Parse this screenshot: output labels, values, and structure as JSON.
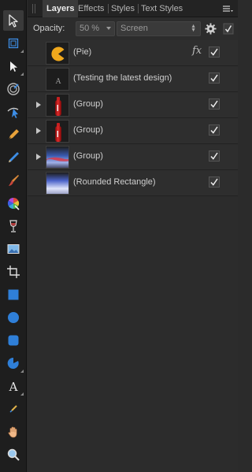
{
  "tabs": [
    {
      "label": "Layers",
      "active": true
    },
    {
      "label": "Effects",
      "active": false
    },
    {
      "label": "Styles",
      "active": false
    },
    {
      "label": "Text Styles",
      "active": false
    }
  ],
  "opacity": {
    "label": "Opacity:",
    "value": "50 %",
    "blend_mode": "Screen"
  },
  "layers": [
    {
      "name": "(Pie)",
      "thumbnail": "pie",
      "expandable": false,
      "has_fx": true,
      "fx_label": "fx",
      "visible": true
    },
    {
      "name": "(Testing the latest design)",
      "thumbnail": "text",
      "thumb_text": "A",
      "expandable": false,
      "has_fx": false,
      "visible": true
    },
    {
      "name": "(Group)",
      "thumbnail": "red-bottle",
      "expandable": true,
      "has_fx": false,
      "visible": true
    },
    {
      "name": "(Group)",
      "thumbnail": "red-bottle",
      "expandable": true,
      "has_fx": false,
      "visible": true
    },
    {
      "name": "(Group)",
      "thumbnail": "blue-red-streak",
      "expandable": true,
      "has_fx": false,
      "visible": true
    },
    {
      "name": "(Rounded Rectangle)",
      "thumbnail": "blue-gradient",
      "expandable": false,
      "has_fx": false,
      "visible": true
    }
  ],
  "tools": [
    {
      "icon": "move-tool-icon",
      "active": true
    },
    {
      "icon": "artboard-tool-icon",
      "active": false
    },
    {
      "icon": "node-tool-icon",
      "active": false
    },
    {
      "icon": "contour-tool-icon",
      "active": false
    },
    {
      "icon": "corner-tool-icon",
      "active": false
    },
    {
      "icon": "pen-tool-icon",
      "active": false
    },
    {
      "icon": "pencil-tool-icon",
      "active": false
    },
    {
      "icon": "brush-tool-icon",
      "active": false
    },
    {
      "icon": "color-picker-icon",
      "active": false
    },
    {
      "icon": "transparency-tool-icon",
      "active": false
    },
    {
      "icon": "place-image-icon",
      "active": false
    },
    {
      "icon": "crop-tool-icon",
      "active": false
    },
    {
      "icon": "rectangle-tool-icon",
      "active": false
    },
    {
      "icon": "ellipse-tool-icon",
      "active": false
    },
    {
      "icon": "rounded-rectangle-tool-icon",
      "active": false
    },
    {
      "icon": "pie-tool-icon",
      "active": false
    },
    {
      "icon": "text-tool-icon",
      "active": false
    },
    {
      "icon": "color-sampler-icon",
      "active": false
    },
    {
      "icon": "hand-tool-icon",
      "active": false
    },
    {
      "icon": "zoom-tool-icon",
      "active": false
    }
  ],
  "colors": {
    "accent": "#1f7fe0",
    "panel_bg": "#2c2c2c",
    "toolbar_bg": "#1e1e1e"
  }
}
